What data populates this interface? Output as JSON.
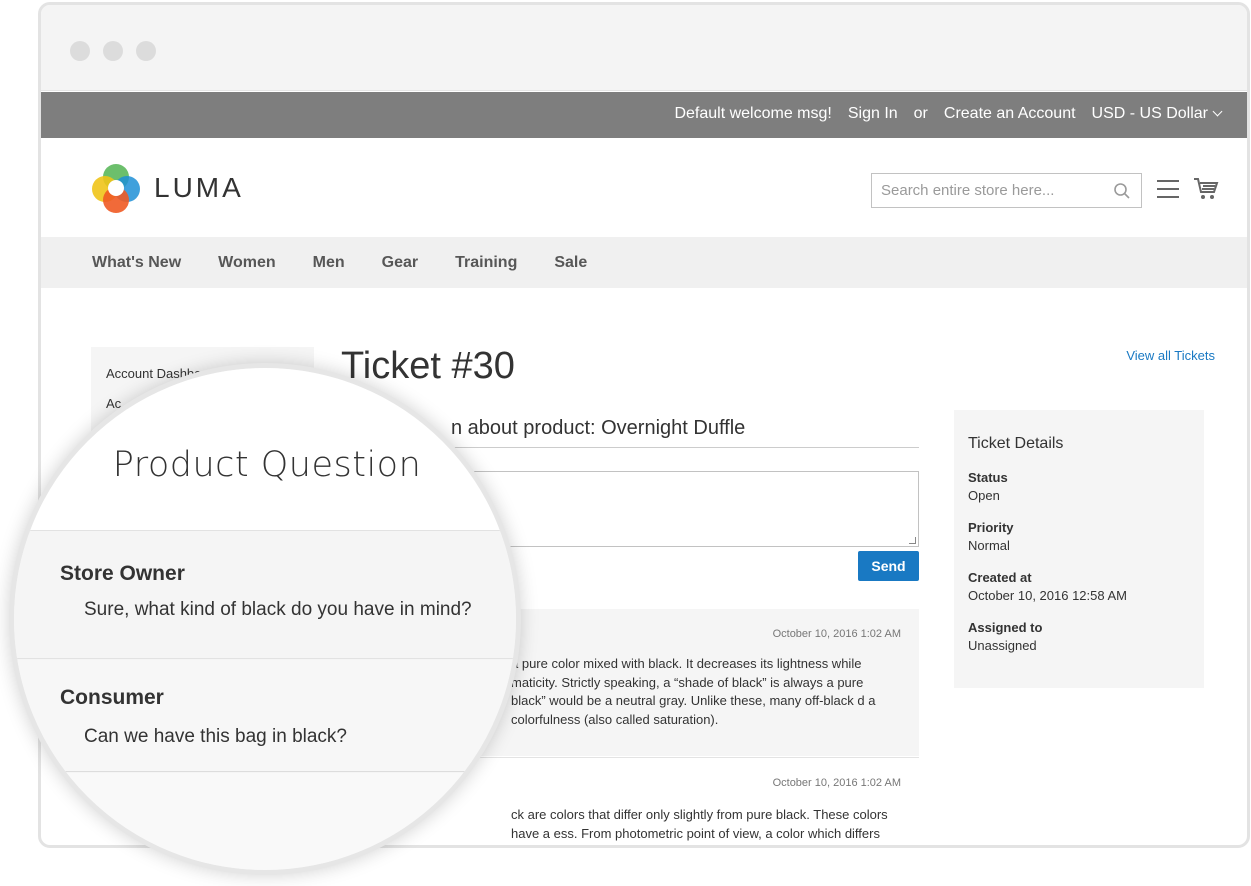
{
  "topbar": {
    "welcome": "Default welcome msg!",
    "sign_in": "Sign In",
    "or": "or",
    "create_account": "Create an Account",
    "currency": "USD - US Dollar"
  },
  "header": {
    "logo_text": "LUMA",
    "search_placeholder": "Search entire store here...",
    "icons": [
      "search-icon",
      "menu-icon",
      "cart-icon"
    ]
  },
  "nav": {
    "items": [
      "What's New",
      "Women",
      "Men",
      "Gear",
      "Training",
      "Sale"
    ]
  },
  "sidebar": {
    "items": [
      "Account Dashboard",
      "Ac"
    ]
  },
  "ticket": {
    "title": "Ticket #30",
    "view_all": "View all Tickets",
    "subject": "n about product: Overnight Duffle",
    "send_label": "Send"
  },
  "messages": [
    {
      "time": "October 10, 2016 1:02 AM",
      "body": "a pure color mixed with black. It decreases its lightness while maticity. Strictly speaking, a “shade of black” is always a pure black” would be a neutral gray. Unlike these, many off-black d a colorfulness (also called saturation)."
    },
    {
      "time": "October 10, 2016 1:02 AM",
      "body": "ck are colors that differ only slightly from pure black. These colors have a ess. From photometric point of view, a color which differs slightly from black"
    }
  ],
  "details": {
    "heading": "Ticket Details",
    "status_label": "Status",
    "status": "Open",
    "priority_label": "Priority",
    "priority": "Normal",
    "created_label": "Created at",
    "created": "October 10, 2016 12:58 AM",
    "assigned_label": "Assigned to",
    "assigned": "Unassigned"
  },
  "magnifier": {
    "title": "Product Question",
    "entries": [
      {
        "author": "Store Owner",
        "text": "Sure, what kind of black do you have in mind?"
      },
      {
        "author": "Consumer",
        "text": "Can we have this bag in black?"
      }
    ]
  },
  "colors": {
    "topbar_bg": "#7e7e7e",
    "accent": "#1979c3",
    "nav_bg": "#f0f0f0"
  }
}
